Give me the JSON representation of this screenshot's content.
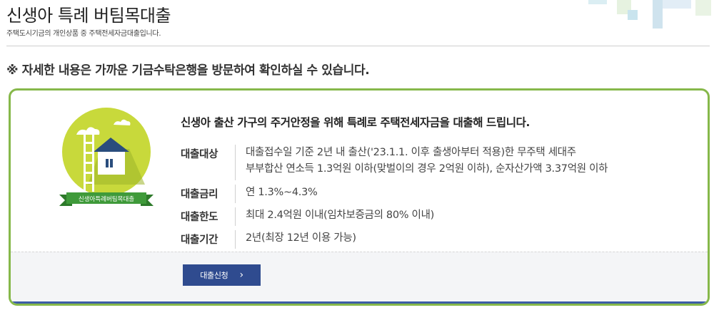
{
  "page": {
    "title": "신생아 특례 버팀목대출",
    "subtitle": "주택도시기금의 개인상품 중 주택전세자금대출입니다."
  },
  "notice": "※ 자세한 내용은 가까운 기금수탁은행을 방문하여 확인하실 수 있습니다.",
  "product": {
    "emblem_label": "신생아특례버팀목대출",
    "headline": "신생아 출산 가구의 주거안정을 위해 특례로 주택전세자금을 대출해 드립니다.",
    "info": {
      "target": {
        "label": "대출대상",
        "line1": "대출접수일 기준 2년 내 출산('23.1.1. 이후 출생아부터 적용)한 무주택 세대주",
        "line2": "부부합산 연소득 1.3억원 이하(맞벌이의 경우 2억원 이하), 순자산가액 3.37억원 이하"
      },
      "rate": {
        "label": "대출금리",
        "value": "연 1.3%~4.3%"
      },
      "limit": {
        "label": "대출한도",
        "value": "최대 2.4억원 이내(임차보증금의 80% 이내)"
      },
      "period": {
        "label": "대출기간",
        "value": "2년(최장 12년 이용 가능)"
      }
    },
    "apply_button": "대출신청",
    "apply_icon": "chevron-right-icon"
  },
  "colors": {
    "card_border": "#86b84a",
    "card_bottom": "#3c5da5",
    "button": "#2f4b8f",
    "emblem_circle": "#c8d93b",
    "ribbon": "#3f9a3a"
  }
}
